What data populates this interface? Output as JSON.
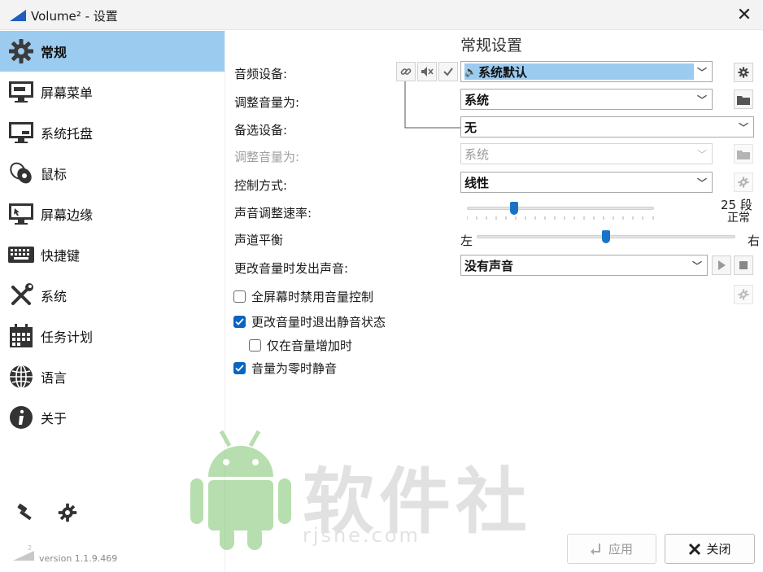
{
  "window": {
    "title": "Volume² - 设置",
    "close_glyph": "✕"
  },
  "sidebar": {
    "items": [
      {
        "label": "常规",
        "icon": "gear-icon",
        "active": true
      },
      {
        "label": "屏幕菜单",
        "icon": "monitor-menu-icon"
      },
      {
        "label": "系统托盘",
        "icon": "monitor-tray-icon"
      },
      {
        "label": "鼠标",
        "icon": "mouse-icon"
      },
      {
        "label": "屏幕边缘",
        "icon": "monitor-edge-icon"
      },
      {
        "label": "快捷键",
        "icon": "keyboard-icon"
      },
      {
        "label": "系统",
        "icon": "wrench-screwdriver-icon"
      },
      {
        "label": "任务计划",
        "icon": "calendar-icon"
      },
      {
        "label": "语言",
        "icon": "globe-icon"
      },
      {
        "label": "关于",
        "icon": "info-icon"
      }
    ],
    "version": "version 1.1.9.469"
  },
  "main": {
    "section_title": "常规设置",
    "audio_device": {
      "label": "音频设备:",
      "value": "系统默认"
    },
    "adjust_volume_1": {
      "label": "调整音量为:",
      "value": "系统"
    },
    "backup_device": {
      "label": "备选设备:",
      "value": "无"
    },
    "adjust_volume_2": {
      "label": "调整音量为:",
      "value": "系统"
    },
    "control_mode": {
      "label": "控制方式:",
      "value": "线性"
    },
    "rate": {
      "label": "声音调整速率:",
      "value": "25 段",
      "sub": "正常",
      "level": 0.25
    },
    "balance": {
      "label": "声道平衡",
      "left": "左",
      "right": "右",
      "level": 0.5
    },
    "sound_on_change": {
      "label": "更改音量时发出声音:",
      "value": "没有声音"
    },
    "checkboxes": [
      {
        "label": "全屏幕时禁用音量控制",
        "checked": false
      },
      {
        "label": "更改音量时退出静音状态",
        "checked": true
      },
      {
        "label": "仅在音量增加时",
        "checked": false
      },
      {
        "label": "音量为零时静音",
        "checked": true
      }
    ]
  },
  "footer": {
    "apply": "应用",
    "close": "关闭"
  },
  "watermark": {
    "text": "软件社",
    "url": "rjshe.com"
  },
  "colors": {
    "accent": "#1873c8",
    "selection": "#9ccbf0",
    "watermark_green": "#7ec46c"
  }
}
